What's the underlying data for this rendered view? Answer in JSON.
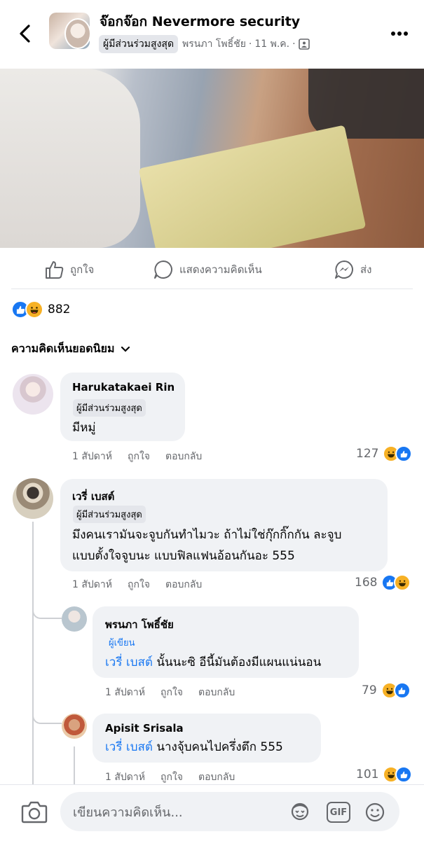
{
  "header": {
    "title": "จ๊อกจ๊อก Nevermore security",
    "badge": "ผู้มีส่วนร่วมสูงสุด",
    "author": "พรนภา โพธิ์ชัย",
    "separator": "·",
    "date": "11 พ.ค.",
    "separator2": "·"
  },
  "actions": {
    "like": "ถูกใจ",
    "comment": "แสดงความคิดเห็น",
    "share": "ส่ง"
  },
  "reactions": {
    "count": "882"
  },
  "sort": {
    "label": "ความคิดเห็นยอดนิยม"
  },
  "comments": [
    {
      "name": "Harukatakaei Rin",
      "role": "ผู้มีส่วนร่วมสูงสุด",
      "text": "มีหมู่",
      "time": "1 สัปดาห์",
      "like": "ถูกใจ",
      "reply": "ตอบกลับ",
      "count": "127"
    },
    {
      "name": "เวรี่ เบสต์",
      "role": "ผู้มีส่วนร่วมสูงสุด",
      "text_line1": "มึงคนเรามันจะจูบกันทำไมวะ ถ้าไม่ใช่กุ๊กกิ๊กกัน ละจูบ",
      "text_line2": "แบบตั้งใจจูบนะ แบบฟิลแฟนอ้อนกันอะ 555",
      "time": "1 สัปดาห์",
      "like": "ถูกใจ",
      "reply": "ตอบกลับ",
      "count": "168"
    },
    {
      "name": "พรนภา โพธิ์ชัย",
      "role": "ผู้เขียน",
      "mention": "เวรี่ เบสต์",
      "text": " นั้นนะซิ อีนี้มันต้องมีแผนแน่นอน",
      "time": "1 สัปดาห์",
      "like": "ถูกใจ",
      "reply": "ตอบกลับ",
      "count": "79"
    },
    {
      "name": "Apisit Srisala",
      "mention": "เวรี่ เบสต์",
      "text": " นางจุ้บคนไปครึ่งตึก 555",
      "time": "1 สัปดาห์",
      "like": "ถูกใจ",
      "reply": "ตอบกลับ",
      "count": "101"
    }
  ],
  "composer": {
    "placeholder": "เขียนความคิดเห็น...",
    "gif": "GIF"
  },
  "colors": {
    "accent": "#1877f2",
    "haha": "#f7b125",
    "text_secondary": "#65676b",
    "bubble": "#f0f2f5"
  }
}
